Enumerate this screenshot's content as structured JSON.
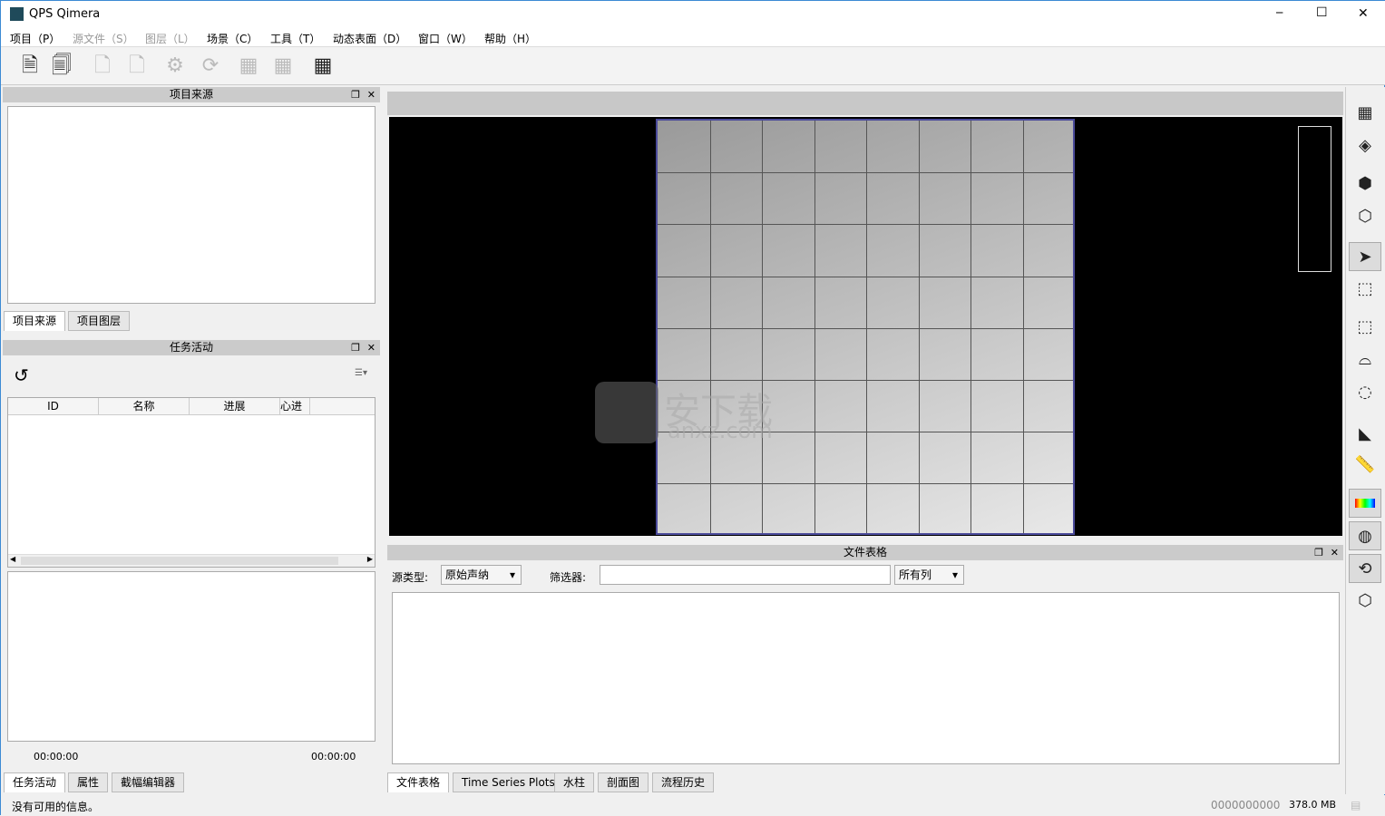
{
  "app": {
    "title": "QPS Qimera",
    "min": "─",
    "max": "☐",
    "close": "✕"
  },
  "menu": [
    {
      "label": "项目（P）",
      "enabled": true
    },
    {
      "label": "源文件（S）",
      "enabled": false
    },
    {
      "label": "图层（L）",
      "enabled": false
    },
    {
      "label": "场景（C）",
      "enabled": true
    },
    {
      "label": "工具（T）",
      "enabled": true
    },
    {
      "label": "动态表面（D）",
      "enabled": true
    },
    {
      "label": "窗口（W）",
      "enabled": true
    },
    {
      "label": "帮助（H）",
      "enabled": true
    }
  ],
  "toolbar": [
    {
      "icon": "new-project-icon",
      "enabled": true
    },
    {
      "icon": "open-project-icon",
      "enabled": true
    },
    {
      "icon": "add-source-icon",
      "enabled": false
    },
    {
      "icon": "add-points-icon",
      "enabled": false
    },
    {
      "icon": "process-gears-icon",
      "enabled": false
    },
    {
      "icon": "refresh-icon",
      "enabled": false
    },
    {
      "icon": "surface-new-icon",
      "enabled": false
    },
    {
      "icon": "surface-lock-icon",
      "enabled": false
    },
    {
      "icon": "surface-edit-icon",
      "enabled": true
    }
  ],
  "project_source": {
    "title": "项目来源",
    "tabs": [
      "项目来源",
      "项目图层"
    ]
  },
  "task_activity": {
    "title": "任务活动",
    "columns": [
      "ID",
      "名称",
      "进展",
      "心进"
    ],
    "time_left": "00:00:00",
    "time_right": "00:00:00",
    "tabs": [
      "任务活动",
      "属性",
      "截幅编辑器"
    ]
  },
  "file_table": {
    "title": "文件表格",
    "source_type_label": "源类型:",
    "source_type_value": "原始声纳",
    "filter_label": "筛选器:",
    "filter_value": "",
    "columns_value": "所有列",
    "tabs": [
      "文件表格",
      "Time Series Plots",
      "水柱",
      "剖面图",
      "流程历史"
    ]
  },
  "status": {
    "message": "没有可用的信息。",
    "coords": "0000000000",
    "memory": "378.0 MB"
  },
  "watermark": {
    "text": "安下载",
    "sub": "anxz.com"
  },
  "right_toolbar": [
    {
      "icon": "grid-icon",
      "selected": false
    },
    {
      "icon": "layers-icon",
      "selected": false
    },
    {
      "icon": "cube-fit-icon",
      "selected": false
    },
    {
      "icon": "cube-icon",
      "selected": false
    },
    {
      "icon": "pointer-icon",
      "selected": true
    },
    {
      "icon": "select-pointer-icon",
      "selected": false
    },
    {
      "icon": "rect-select-icon",
      "selected": false
    },
    {
      "icon": "poly-select-icon",
      "selected": false
    },
    {
      "icon": "lasso-icon",
      "selected": false
    },
    {
      "icon": "profile-icon",
      "selected": false
    },
    {
      "icon": "ruler-icon",
      "selected": false
    },
    {
      "icon": "colormap-icon",
      "selected": true
    },
    {
      "icon": "sphere-grid-icon",
      "selected": true
    },
    {
      "icon": "rotate-icon",
      "selected": true
    },
    {
      "icon": "axes-cube-icon",
      "selected": false
    }
  ],
  "colors": {
    "viewport": "#000000",
    "grid_border": "#4a4a9a",
    "panel_header": "#cbcbcb"
  }
}
